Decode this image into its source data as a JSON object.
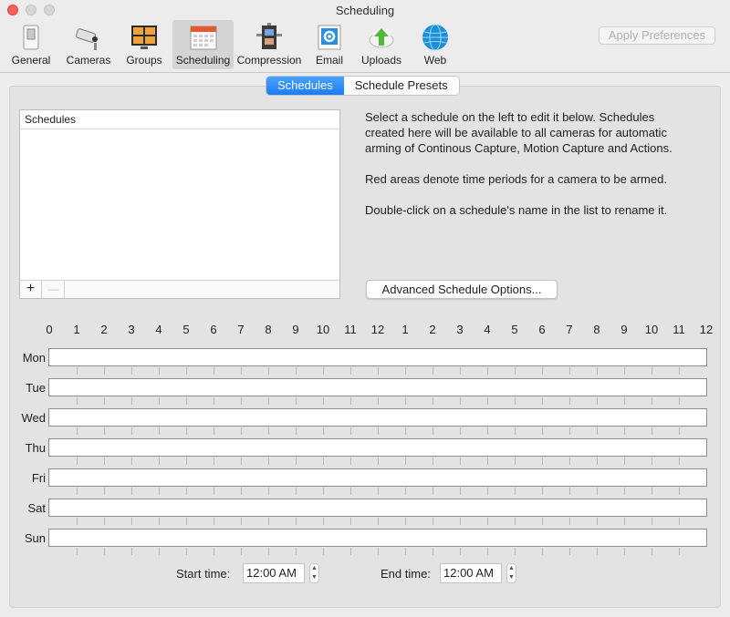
{
  "window": {
    "title": "Scheduling"
  },
  "toolbar": {
    "items": [
      {
        "label": "General",
        "icon": "switch-icon"
      },
      {
        "label": "Cameras",
        "icon": "security-camera-icon"
      },
      {
        "label": "Groups",
        "icon": "groups-grid-icon"
      },
      {
        "label": "Scheduling",
        "icon": "calendar-icon"
      },
      {
        "label": "Compression",
        "icon": "film-clamp-icon"
      },
      {
        "label": "Email",
        "icon": "email-gear-icon"
      },
      {
        "label": "Uploads",
        "icon": "cloud-upload-icon"
      },
      {
        "label": "Web",
        "icon": "globe-icon"
      }
    ],
    "apply_label": "Apply Preferences",
    "selected": "Scheduling"
  },
  "tabs": {
    "schedules": "Schedules",
    "presets": "Schedule Presets",
    "selected": "Schedules"
  },
  "list": {
    "header": "Schedules",
    "add": "+",
    "remove": "—"
  },
  "info": {
    "p1_line1": "Select a schedule on the left to edit it below. Schedules",
    "p1_line2": "created here will be available to all cameras for automatic",
    "p1_line3": "arming of Continous Capture, Motion Capture and Actions.",
    "p2": "Red areas denote time periods for a camera to be armed.",
    "p3": "Double-click on a schedule's name in the list to rename it."
  },
  "advanced_button": "Advanced Schedule Options...",
  "hours": [
    "0",
    "1",
    "2",
    "3",
    "4",
    "5",
    "6",
    "7",
    "8",
    "9",
    "10",
    "11",
    "12",
    "1",
    "2",
    "3",
    "4",
    "5",
    "6",
    "7",
    "8",
    "9",
    "10",
    "11",
    "12"
  ],
  "days": [
    "Mon",
    "Tue",
    "Wed",
    "Thu",
    "Fri",
    "Sat",
    "Sun"
  ],
  "start_time": {
    "label": "Start time:",
    "value": "12:00 AM"
  },
  "end_time": {
    "label": "End time:",
    "value": "12:00 AM"
  },
  "colors": {
    "accent": "#1b7cf5",
    "close": "#fc5f57"
  }
}
